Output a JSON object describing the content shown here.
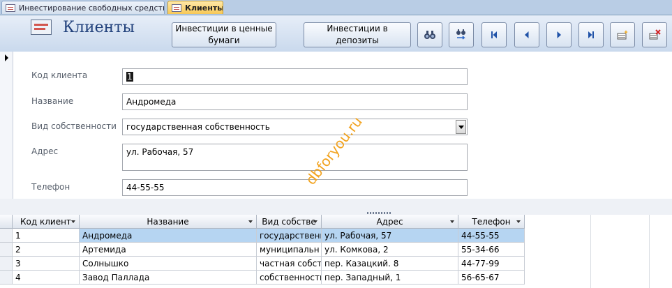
{
  "tabs": [
    {
      "label": "Инвестирование свободных средств",
      "active": false
    },
    {
      "label": "Клиенты",
      "active": true
    }
  ],
  "header": {
    "title": "Клиенты",
    "buttons": {
      "securities": "Инвестиции в ценные бумаги",
      "deposits": "Инвестиции в депозиты"
    },
    "icon_buttons": [
      "find-icon",
      "replace-icon",
      "first-record-icon",
      "previous-record-icon",
      "next-record-icon",
      "last-record-icon",
      "new-record-icon",
      "delete-record-icon"
    ]
  },
  "form": {
    "fields": {
      "client_code": {
        "label": "Код клиента",
        "value": "1"
      },
      "name": {
        "label": "Название",
        "value": "Андромеда"
      },
      "ownership": {
        "label": "Вид собственности",
        "value": "государственная собственность"
      },
      "address": {
        "label": "Адрес",
        "value": "ул. Рабочая, 57"
      },
      "phone": {
        "label": "Телефон",
        "value": "44-55-55"
      }
    }
  },
  "watermark": "dbforyou.ru",
  "datasheet": {
    "columns": [
      "Код клиент",
      "Название",
      "Вид собстве",
      "Адрес",
      "Телефон"
    ],
    "rows": [
      [
        "1",
        "Андромеда",
        "государственн",
        "ул. Рабочая, 57",
        "44-55-55"
      ],
      [
        "2",
        "Артемида",
        "муниципальн",
        "ул. Комкова, 2",
        "55-34-66"
      ],
      [
        "3",
        "Солнышко",
        "частная собсте",
        "пер. Казацкий. 8",
        "44-77-99"
      ],
      [
        "4",
        "Завод Паллада",
        "собственность",
        "пер. Западный, 1",
        "56-65-67"
      ]
    ],
    "current_row": 0
  },
  "colors": {
    "tab_active": "#f7c857",
    "header_bg": "#c9d9ed",
    "title": "#1f3f7a",
    "selection": "#b6d5f2",
    "watermark": "#f2a31f"
  }
}
